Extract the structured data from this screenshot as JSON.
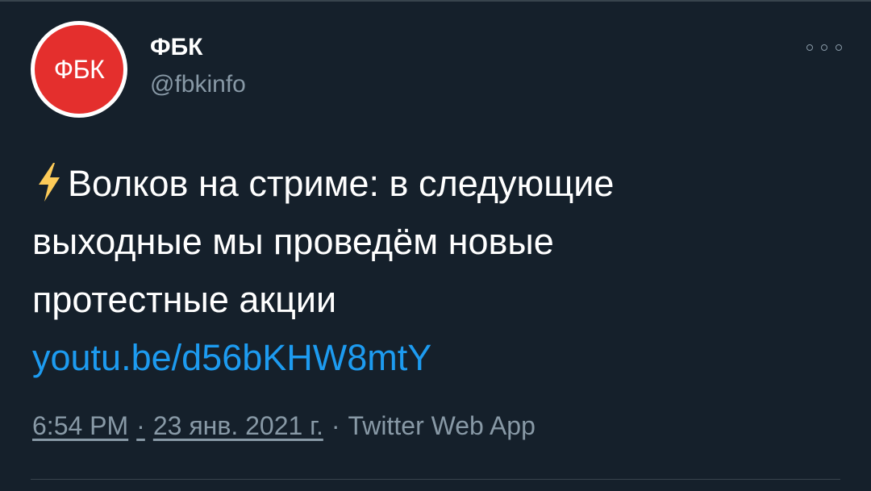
{
  "user": {
    "avatar_text": "ФБК",
    "name": "ФБК",
    "handle": "@fbkinfo"
  },
  "tweet": {
    "emoji_icon": "high-voltage-icon",
    "text_lines": [
      "Волков на стриме: в следующие",
      "выходные мы проведём новые",
      "протестные акции"
    ],
    "link": "youtu.be/d56bKHW8mtY"
  },
  "meta": {
    "time": "6:54 PM",
    "separator": "·",
    "date": "23 янв. 2021 г.",
    "source": "Twitter Web App"
  },
  "colors": {
    "background": "#15202b",
    "accent": "#1d9bf0",
    "secondary_text": "#8899a6",
    "avatar_red": "#e42f2d",
    "bolt_yellow": "#fdcb58"
  }
}
